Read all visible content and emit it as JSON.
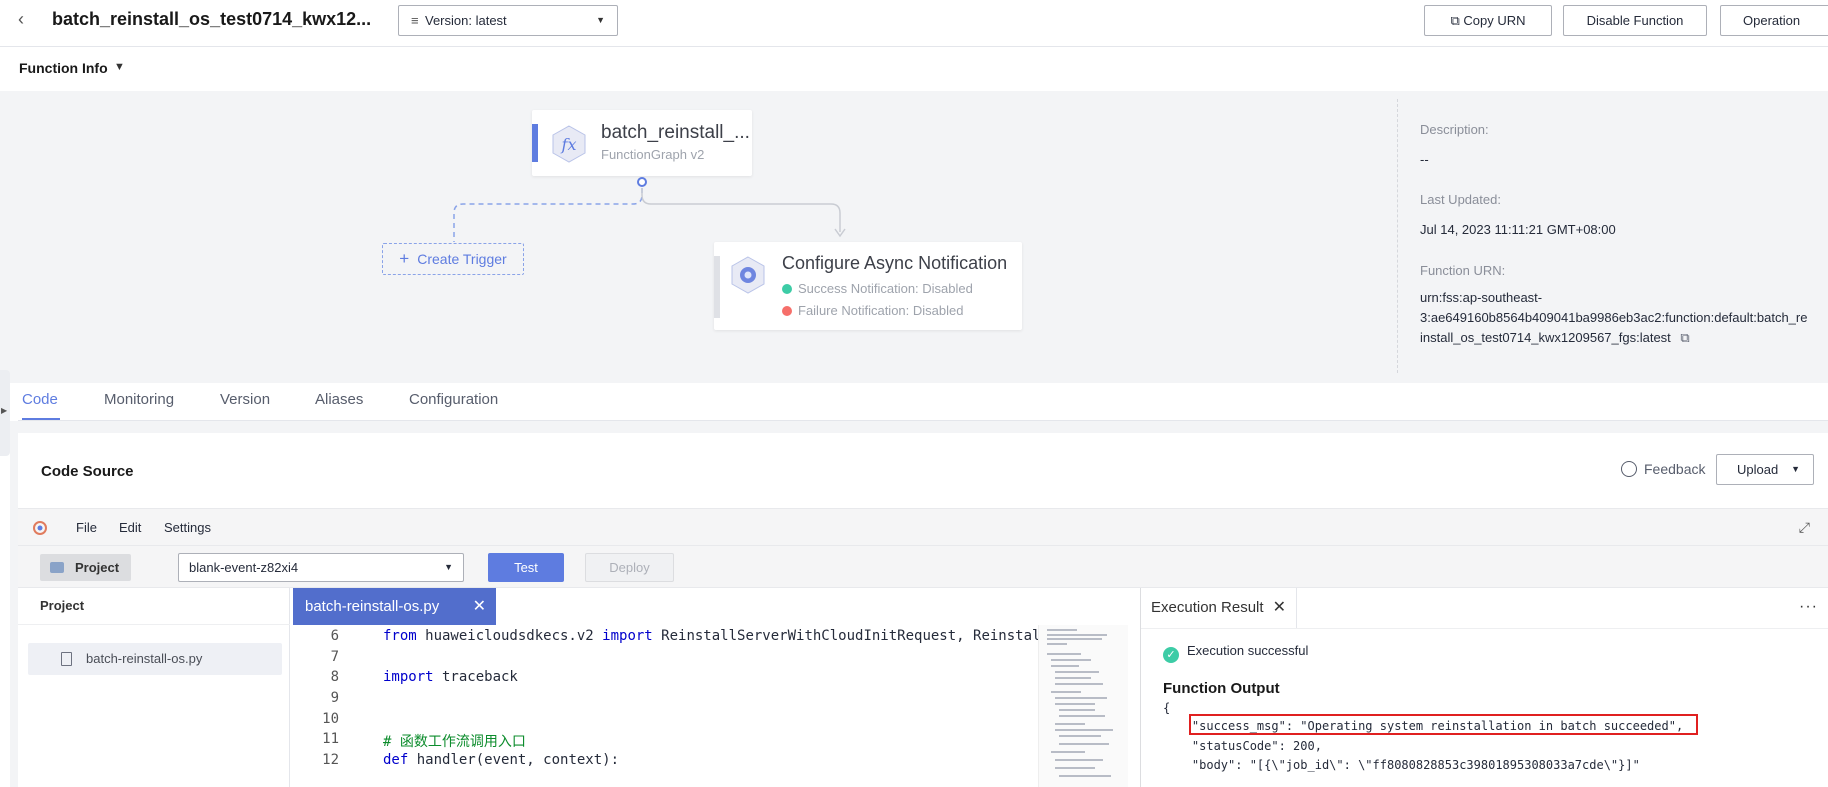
{
  "header": {
    "title": "batch_reinstall_os_test0714_kwx12...",
    "version_label": "Version: latest",
    "copy_urn_label": "Copy URN",
    "disable_label": "Disable Function",
    "operation_label": "Operation"
  },
  "function_info": {
    "label": "Function Info"
  },
  "diagram": {
    "function_node": {
      "name": "batch_reinstall_...",
      "runtime": "FunctionGraph v2"
    },
    "trigger_label": "Create Trigger",
    "async_node": {
      "title": "Configure Async Notification",
      "success": "Success Notification: Disabled",
      "failure": "Failure Notification: Disabled",
      "success_color": "#3dcca6",
      "failure_color": "#f66f6a"
    }
  },
  "meta": {
    "description_label": "Description:",
    "description_value": "--",
    "last_updated_label": "Last Updated:",
    "last_updated_value": "Jul 14, 2023 11:11:21 GMT+08:00",
    "urn_label": "Function URN:",
    "urn_line1": "urn:fss:ap-southeast-",
    "urn_line2": "3:ae649160b8564b409041ba9986eb3ac2:function:default:batch_re",
    "urn_line3": "install_os_test0714_kwx1209567_fgs:latest"
  },
  "tabs": [
    "Code",
    "Monitoring",
    "Version",
    "Aliases",
    "Configuration"
  ],
  "code_source": {
    "title": "Code Source",
    "feedback_label": "Feedback",
    "upload_label": "Upload"
  },
  "ide": {
    "menu": [
      "File",
      "Edit",
      "Settings"
    ],
    "project_button": "Project",
    "event_select": "blank-event-z82xi4",
    "test_label": "Test",
    "deploy_label": "Deploy",
    "project_pane_title": "Project",
    "file_name": "batch-reinstall-os.py",
    "open_tab": "batch-reinstall-os.py"
  },
  "code_lines": [
    {
      "num": "6",
      "text": "from huaweicloudsdkecs.v2 import ReinstallServerWithCloudInitRequest, Reinstall"
    },
    {
      "num": "7",
      "text": ""
    },
    {
      "num": "8",
      "text": "import traceback"
    },
    {
      "num": "9",
      "text": ""
    },
    {
      "num": "10",
      "text": ""
    },
    {
      "num": "11",
      "text": "# 函数工作流调用入口"
    },
    {
      "num": "12",
      "text": "def handler(event, context):"
    }
  ],
  "result": {
    "tab_label": "Execution Result",
    "status": "Execution successful",
    "output_title": "Function Output",
    "json_lines": [
      "{",
      "    \"success_msg\": \"Operating system reinstallation in batch succeeded\",",
      "    \"statusCode\": 200,",
      "    \"body\": \"[{\\\"job_id\\\": \\\"ff8080828853c39801895308033a7cde\\\"}]\""
    ]
  },
  "colors": {
    "accent": "#5e7ce0",
    "highlight_border": "#e02020"
  }
}
